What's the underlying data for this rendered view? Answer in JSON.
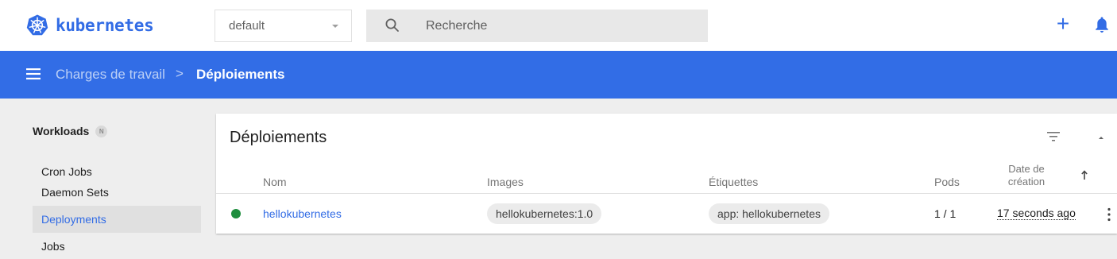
{
  "header": {
    "logo_text": "kubernetes",
    "namespace": {
      "value": "default"
    },
    "search": {
      "placeholder": "Recherche"
    },
    "add_label": "+",
    "icons": {
      "logo": "kubernetes-helm-wheel-icon",
      "search": "search-icon",
      "bell": "bell-icon",
      "menu": "menu-icon"
    },
    "brand_color": "#326ce5"
  },
  "breadcrumb": {
    "parent": "Charges de travail",
    "separator": ">",
    "current": "Déploiements",
    "bar_color": "#326de6"
  },
  "sidebar": {
    "section": {
      "label": "Workloads",
      "badge": "N"
    },
    "items": [
      {
        "label": "Cron Jobs",
        "active": false
      },
      {
        "label": "Daemon Sets",
        "active": false
      },
      {
        "label": "Deployments",
        "active": true
      },
      {
        "label": "Jobs",
        "active": false
      }
    ]
  },
  "card": {
    "title": "Déploiements",
    "columns": {
      "name": "Nom",
      "images": "Images",
      "labels": "Étiquettes",
      "pods": "Pods",
      "created_line1": "Date de",
      "created_line2": "création"
    },
    "rows": [
      {
        "status": "running",
        "status_color": "#1e8e3e",
        "name": "hellokubernetes",
        "image": "hellokubernetes:1.0",
        "label": "app: hellokubernetes",
        "pods": "1 / 1",
        "created": "17 seconds ago"
      }
    ]
  }
}
